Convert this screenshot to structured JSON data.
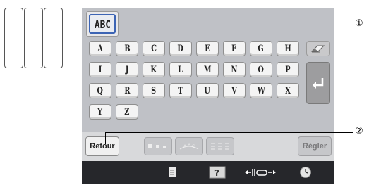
{
  "keyboard": {
    "rows": [
      [
        "A",
        "B",
        "C",
        "D",
        "E",
        "F",
        "G",
        "H"
      ],
      [
        "I",
        "J",
        "K",
        "L",
        "M",
        "N",
        "O",
        "P"
      ],
      [
        "Q",
        "R",
        "S",
        "T",
        "U",
        "V",
        "W",
        "X"
      ],
      [
        "Y",
        "Z"
      ]
    ]
  },
  "font_button": {
    "sample": "ABC"
  },
  "buttons": {
    "back_label": "Retour",
    "set_label": "Régler"
  },
  "callouts": {
    "one": "①",
    "two": "②"
  },
  "colors": {
    "screen_bg": "#bfc1c6",
    "status_bar": "#26272b",
    "font_select_border": "#3c64b4"
  },
  "icons": {
    "eraser": "eraser-icon",
    "enter": "enter-icon",
    "document": "document-icon",
    "help": "help-icon",
    "width": "width-adjust-icon",
    "clock": "clock-icon"
  }
}
